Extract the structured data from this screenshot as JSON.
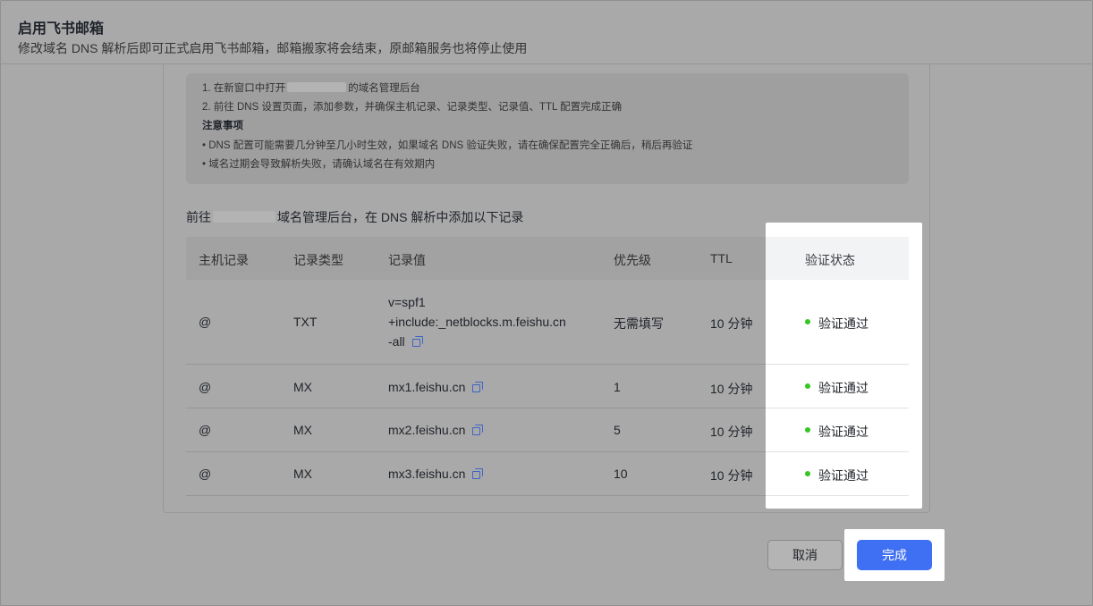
{
  "header": {
    "title": "启用飞书邮箱",
    "subtitle": "修改域名 DNS 解析后即可正式启用飞书邮箱，邮箱搬家将会结束，原邮箱服务也将停止使用"
  },
  "notice": {
    "step1_prefix": "1. 在新窗口中打开",
    "step1_suffix": "的域名管理后台",
    "step2": "2. 前往 DNS 设置页面，添加参数，并确保主机记录、记录类型、记录值、TTL 配置完成正确",
    "caution_title": "注意事项",
    "bullet1": "• DNS 配置可能需要几分钟至几小时生效，如果域名 DNS 验证失败，请在确保配置完全正确后，稍后再验证",
    "bullet2": "• 域名过期会导致解析失败，请确认域名在有效期内"
  },
  "intro": {
    "prefix": "前往",
    "suffix": "域名管理后台，在 DNS 解析中添加以下记录"
  },
  "table": {
    "headers": [
      "主机记录",
      "记录类型",
      "记录值",
      "优先级",
      "TTL",
      "验证状态"
    ],
    "rows": [
      {
        "host": "@",
        "type": "TXT",
        "value_lines": [
          "v=spf1",
          "+include:_netblocks.m.feishu.cn",
          "-all"
        ],
        "priority": "无需填写",
        "ttl": "10 分钟",
        "status": "验证通过"
      },
      {
        "host": "@",
        "type": "MX",
        "value": "mx1.feishu.cn",
        "priority": "1",
        "ttl": "10 分钟",
        "status": "验证通过"
      },
      {
        "host": "@",
        "type": "MX",
        "value": "mx2.feishu.cn",
        "priority": "5",
        "ttl": "10 分钟",
        "status": "验证通过"
      },
      {
        "host": "@",
        "type": "MX",
        "value": "mx3.feishu.cn",
        "priority": "10",
        "ttl": "10 分钟",
        "status": "验证通过"
      }
    ]
  },
  "footer": {
    "cancel_label": "取消",
    "done_label": "完成"
  },
  "colors": {
    "primary": "#3f6ff2",
    "status_success": "#34c724",
    "copy_icon": "#3f63c8",
    "overlay": "#a9a9a9"
  },
  "icons": {
    "copy": "copy-icon",
    "status": "status-dot-icon"
  }
}
